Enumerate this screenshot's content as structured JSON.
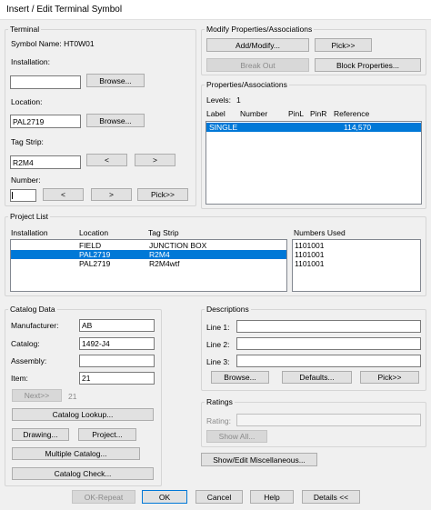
{
  "window": {
    "title": "Insert / Edit Terminal Symbol"
  },
  "terminal": {
    "group_title": "Terminal",
    "symbol_name_label": "Symbol Name: HT0W01",
    "installation_label": "Installation:",
    "installation_value": "",
    "browse_label": "Browse...",
    "location_label": "Location:",
    "location_value": "PAL2719",
    "tag_strip_label": "Tag Strip:",
    "tag_strip_value": "R2M4",
    "prev_label": "<",
    "next_label": ">",
    "number_label": "Number:",
    "number_value": "",
    "pick_label": "Pick>>"
  },
  "modify": {
    "group_title": "Modify Properties/Associations",
    "add_modify_label": "Add/Modify...",
    "pick_label": "Pick>>",
    "break_out_label": "Break Out",
    "block_properties_label": "Block Properties..."
  },
  "properties": {
    "group_title": "Properties/Associations",
    "levels_label": "Levels:",
    "levels_value": "1",
    "columns": [
      "Label",
      "Number",
      "PinL",
      "PinR",
      "Reference"
    ],
    "rows": [
      {
        "label": "SINGLE",
        "number": "",
        "pinl": "",
        "pinr": "",
        "reference": "114,570",
        "selected": true
      }
    ]
  },
  "project_list": {
    "group_title": "Project List",
    "columns": [
      "Installation",
      "Location",
      "Tag Strip"
    ],
    "rows": [
      {
        "installation": "",
        "location": "FIELD",
        "tag_strip": "JUNCTION BOX",
        "selected": false
      },
      {
        "installation": "",
        "location": "PAL2719",
        "tag_strip": "R2M4",
        "selected": true
      },
      {
        "installation": "",
        "location": "PAL2719",
        "tag_strip": "R2M4wtf",
        "selected": false
      }
    ],
    "numbers_used_label": "Numbers Used",
    "numbers_used": [
      "1101001",
      "1101001",
      "1101001"
    ]
  },
  "catalog": {
    "group_title": "Catalog Data",
    "manufacturer_label": "Manufacturer:",
    "manufacturer_value": "AB",
    "catalog_label": "Catalog:",
    "catalog_value": "1492-J4",
    "assembly_label": "Assembly:",
    "assembly_value": "",
    "item_label": "Item:",
    "item_value": "21",
    "next_label": "Next>>",
    "next_count": "21",
    "lookup_label": "Catalog Lookup...",
    "drawing_label": "Drawing...",
    "project_label": "Project...",
    "multiple_label": "Multiple Catalog...",
    "check_label": "Catalog Check..."
  },
  "descriptions": {
    "group_title": "Descriptions",
    "line1_label": "Line 1:",
    "line1_value": "",
    "line2_label": "Line 2:",
    "line2_value": "",
    "line3_label": "Line 3:",
    "line3_value": "",
    "browse_label": "Browse...",
    "defaults_label": "Defaults...",
    "pick_label": "Pick>>"
  },
  "ratings": {
    "group_title": "Ratings",
    "rating_label": "Rating:",
    "rating_value": "",
    "show_all_label": "Show All..."
  },
  "misc": {
    "show_edit_label": "Show/Edit Miscellaneous..."
  },
  "footer": {
    "ok_repeat_label": "OK-Repeat",
    "ok_label": "OK",
    "cancel_label": "Cancel",
    "help_label": "Help",
    "details_label": "Details <<"
  }
}
